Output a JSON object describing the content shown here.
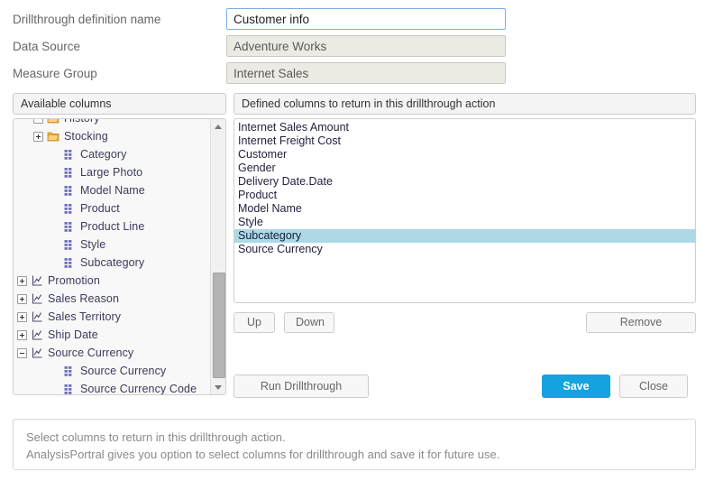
{
  "form": {
    "rows": [
      {
        "label": "Drillthrough definition name",
        "value": "Customer info",
        "state": "focused"
      },
      {
        "label": "Data Source",
        "value": "Adventure Works",
        "state": "readonly"
      },
      {
        "label": "Measure Group",
        "value": "Internet Sales",
        "state": "readonly"
      }
    ]
  },
  "panels": {
    "available_header": "Available columns",
    "defined_header": "Defined columns to return in this drillthrough action"
  },
  "tree": {
    "nodes": [
      {
        "label": "History",
        "indent": 1,
        "expander": "minus",
        "icon": "folder-icon"
      },
      {
        "label": "Stocking",
        "indent": 1,
        "expander": "plus",
        "icon": "folder-icon"
      },
      {
        "label": "Category",
        "indent": 2,
        "expander": "none",
        "icon": "column-icon"
      },
      {
        "label": "Large Photo",
        "indent": 2,
        "expander": "none",
        "icon": "column-icon"
      },
      {
        "label": "Model Name",
        "indent": 2,
        "expander": "none",
        "icon": "column-icon"
      },
      {
        "label": "Product",
        "indent": 2,
        "expander": "none",
        "icon": "column-icon"
      },
      {
        "label": "Product Line",
        "indent": 2,
        "expander": "none",
        "icon": "column-icon"
      },
      {
        "label": "Style",
        "indent": 2,
        "expander": "none",
        "icon": "column-icon"
      },
      {
        "label": "Subcategory",
        "indent": 2,
        "expander": "none",
        "icon": "column-icon"
      },
      {
        "label": "Promotion",
        "indent": 0,
        "expander": "plus",
        "icon": "dimension-icon"
      },
      {
        "label": "Sales Reason",
        "indent": 0,
        "expander": "plus",
        "icon": "dimension-icon"
      },
      {
        "label": "Sales Territory",
        "indent": 0,
        "expander": "plus",
        "icon": "dimension-icon"
      },
      {
        "label": "Ship Date",
        "indent": 0,
        "expander": "plus",
        "icon": "dimension-icon"
      },
      {
        "label": "Source Currency",
        "indent": 0,
        "expander": "minus",
        "icon": "dimension-icon"
      },
      {
        "label": "Source Currency",
        "indent": 2,
        "expander": "none",
        "icon": "column-icon"
      },
      {
        "label": "Source Currency Code",
        "indent": 2,
        "expander": "none",
        "icon": "column-icon"
      }
    ]
  },
  "defined_columns": {
    "items": [
      {
        "label": "Internet Sales Amount",
        "selected": false
      },
      {
        "label": "Internet Freight Cost",
        "selected": false
      },
      {
        "label": "Customer",
        "selected": false
      },
      {
        "label": "Gender",
        "selected": false
      },
      {
        "label": "Delivery Date.Date",
        "selected": false
      },
      {
        "label": "Product",
        "selected": false
      },
      {
        "label": "Model Name",
        "selected": false
      },
      {
        "label": "Style",
        "selected": false
      },
      {
        "label": "Subcategory",
        "selected": true
      },
      {
        "label": "Source Currency",
        "selected": false
      }
    ]
  },
  "buttons": {
    "up": "Up",
    "down": "Down",
    "remove": "Remove",
    "run_drillthrough": "Run Drillthrough",
    "save": "Save",
    "close": "Close"
  },
  "info": {
    "line1": "Select columns to return in this drillthrough action.",
    "line2": "AnalysisPortral gives you option to select columns for drillthrough and save it for future use."
  },
  "colors": {
    "accent": "#14a3dd",
    "selection": "#aed8e6",
    "readonly_field": "#ebebe4",
    "focus_border": "#7aaeea"
  }
}
